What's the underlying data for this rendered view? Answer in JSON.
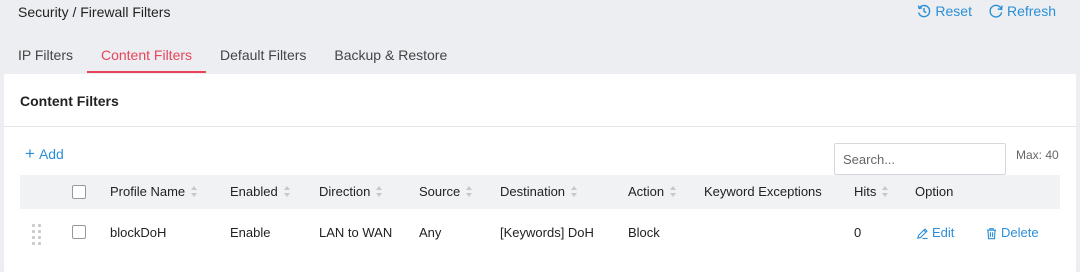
{
  "header": {
    "breadcrumb": "Security / Firewall Filters",
    "reset_label": "Reset",
    "refresh_label": "Refresh"
  },
  "tabs": [
    {
      "label": "IP Filters",
      "active": false
    },
    {
      "label": "Content Filters",
      "active": true
    },
    {
      "label": "Default Filters",
      "active": false
    },
    {
      "label": "Backup & Restore",
      "active": false
    }
  ],
  "card": {
    "title": "Content Filters",
    "add_label": "Add",
    "search_placeholder": "Search...",
    "max_label": "Max: 40"
  },
  "table": {
    "columns": [
      "Profile Name",
      "Enabled",
      "Direction",
      "Source",
      "Destination",
      "Action",
      "Keyword Exceptions",
      "Hits",
      "Option"
    ],
    "rows": [
      {
        "profile_name": "blockDoH",
        "enabled": "Enable",
        "direction": "LAN to WAN",
        "source": "Any",
        "destination": "[Keywords] DoH",
        "action": "Block",
        "keyword_exceptions": "",
        "hits": "0",
        "edit_label": "Edit",
        "delete_label": "Delete"
      }
    ]
  },
  "colors": {
    "accent": "#2b8fd8",
    "active_tab": "#e8455a",
    "background": "#eceef1"
  },
  "icons": [
    "reset-icon",
    "refresh-icon",
    "plus-icon",
    "sort-icon",
    "drag-handle-icon",
    "edit-icon",
    "delete-icon"
  ]
}
